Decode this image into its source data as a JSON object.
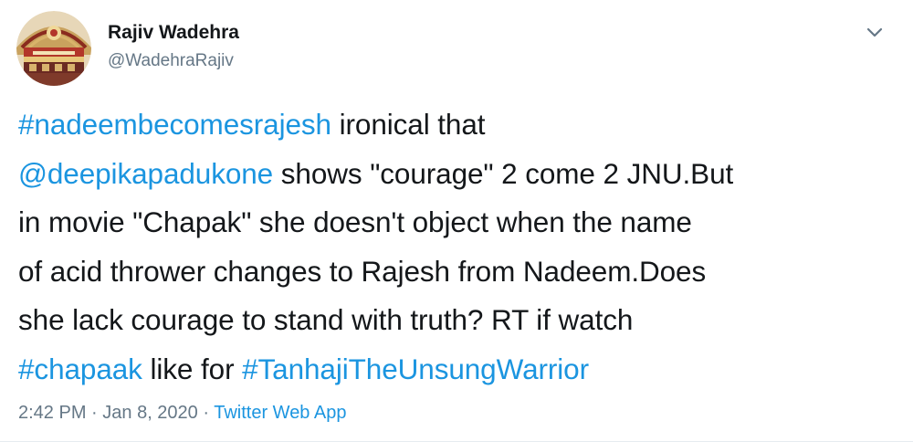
{
  "author": {
    "display_name": "Rajiv Wadehra",
    "handle": "@WadehraRajiv"
  },
  "tweet": {
    "lines": [
      [
        {
          "text": "#nadeembecomesrajesh",
          "link": true
        },
        {
          "text": " ironical that",
          "link": false
        }
      ],
      [
        {
          "text": "@deepikapadukone",
          "link": true
        },
        {
          "text": " shows \"courage\" 2 come 2 JNU.But",
          "link": false
        }
      ],
      [
        {
          "text": "in movie \"Chapak\" she doesn't object when the name",
          "link": false
        }
      ],
      [
        {
          "text": "of acid thrower changes to Rajesh from Nadeem.Does",
          "link": false
        }
      ],
      [
        {
          "text": "she lack courage to stand with truth? RT if watch",
          "link": false
        }
      ],
      [
        {
          "text": "#chapaak",
          "link": true
        },
        {
          "text": " like for ",
          "link": false
        },
        {
          "text": "#TanhajiTheUnsungWarrior",
          "link": true
        }
      ]
    ]
  },
  "meta": {
    "time": "2:42 PM",
    "separator": " · ",
    "date": "Jan 8, 2020",
    "source": "Twitter Web App"
  },
  "colors": {
    "link": "#1b95e0",
    "secondary_text": "#657786",
    "primary_text": "#14171a"
  },
  "icons": {
    "caret": "chevron-down-icon",
    "avatar": "profile-avatar"
  }
}
